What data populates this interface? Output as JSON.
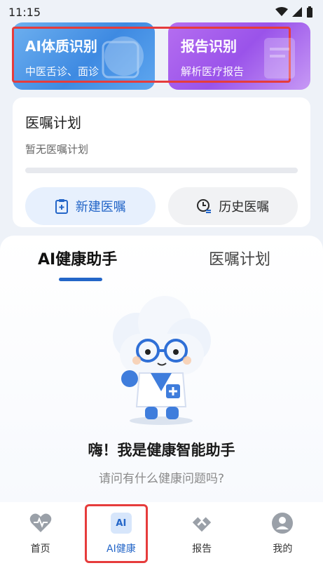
{
  "status_bar": {
    "time": "11:15"
  },
  "feature_cards": [
    {
      "title": "AI体质识别",
      "subtitle": "中医舌诊、面诊"
    },
    {
      "title": "报告识别",
      "subtitle": "解析医疗报告"
    }
  ],
  "plan": {
    "title": "医嘱计划",
    "empty_text": "暂无医嘱计划",
    "progress": 0,
    "new_button": "新建医嘱",
    "history_button": "历史医嘱"
  },
  "tabs": {
    "ai_assistant": "AI健康助手",
    "plan": "医嘱计划"
  },
  "assistant": {
    "greeting": "嗨！我是健康智能助手",
    "question": "请问有什么健康问题吗?"
  },
  "bottom_nav": [
    {
      "label": "首页",
      "icon": "heart-pulse-icon"
    },
    {
      "label": "AI健康",
      "icon": "ai-icon",
      "icon_text": "AI"
    },
    {
      "label": "报告",
      "icon": "report-icon"
    },
    {
      "label": "我的",
      "icon": "user-icon"
    }
  ],
  "colors": {
    "accent": "#2466c8",
    "highlight": "#e63c3c"
  }
}
